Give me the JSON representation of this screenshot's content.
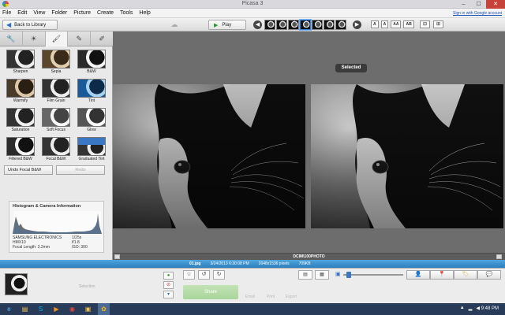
{
  "window": {
    "title": "Picasa 3",
    "buttons": {
      "minimize": "–",
      "maximize": "☐",
      "close": "✕"
    }
  },
  "menu": {
    "items": [
      "File",
      "Edit",
      "View",
      "Folder",
      "Picture",
      "Create",
      "Tools",
      "Help"
    ],
    "signin": "Sign in with Google account"
  },
  "toolbar": {
    "back_label": "Back to Library",
    "play_label": "Play",
    "text_buttons": [
      "A",
      "A",
      "AA",
      "AB"
    ]
  },
  "tool_tabs": [
    "wrench-icon",
    "sun-icon",
    "brush-icon",
    "bw-brush-icon",
    "paint-brush-icon"
  ],
  "effects": [
    {
      "label": "Sharpen",
      "style": "t-plain"
    },
    {
      "label": "Sepia",
      "style": "t-sepia"
    },
    {
      "label": "B&W",
      "style": "t-bw"
    },
    {
      "label": "Warmify",
      "style": "t-warm"
    },
    {
      "label": "Film Grain",
      "style": "t-plain"
    },
    {
      "label": "Tint",
      "style": "t-blue"
    },
    {
      "label": "Saturation",
      "style": "t-plain"
    },
    {
      "label": "Soft Focus",
      "style": "t-soft"
    },
    {
      "label": "Glow",
      "style": "t-glow"
    },
    {
      "label": "Filtered B&W",
      "style": "t-bw"
    },
    {
      "label": "Focal B&W",
      "style": "t-plain"
    },
    {
      "label": "Graduated Tint",
      "style": "t-grad"
    }
  ],
  "panel_buttons": {
    "undo": "Undo Focal B&W",
    "redo": "Redo"
  },
  "histogram": {
    "title": "Histogram & Camera Information",
    "camera": [
      {
        "left": "SAMSUNG ELECTRONICS",
        "right": "1/25s"
      },
      {
        "left": "HMX10",
        "right": "f/1.8"
      },
      {
        "left": "Focal Length: 3.2mm",
        "right": "ISO: 300"
      }
    ]
  },
  "main": {
    "selected_label": "Selected",
    "folder_path": "DCIM\\100PHOTO"
  },
  "infostrip": {
    "filename": "01.jpg",
    "date": "3/24/2013 6:30:08 PM",
    "dimensions": "2048x1536 pixels",
    "size": "709KB"
  },
  "tray": {
    "selection_label": "Selection",
    "share_label": "Share",
    "actions": [
      "Email",
      "Print",
      "Export"
    ]
  },
  "taskbar": {
    "clock": "9:48 PM"
  },
  "colors": {
    "accent": "#2c7fbd",
    "taskbar": "#283c5a",
    "close": "#c7433a"
  }
}
